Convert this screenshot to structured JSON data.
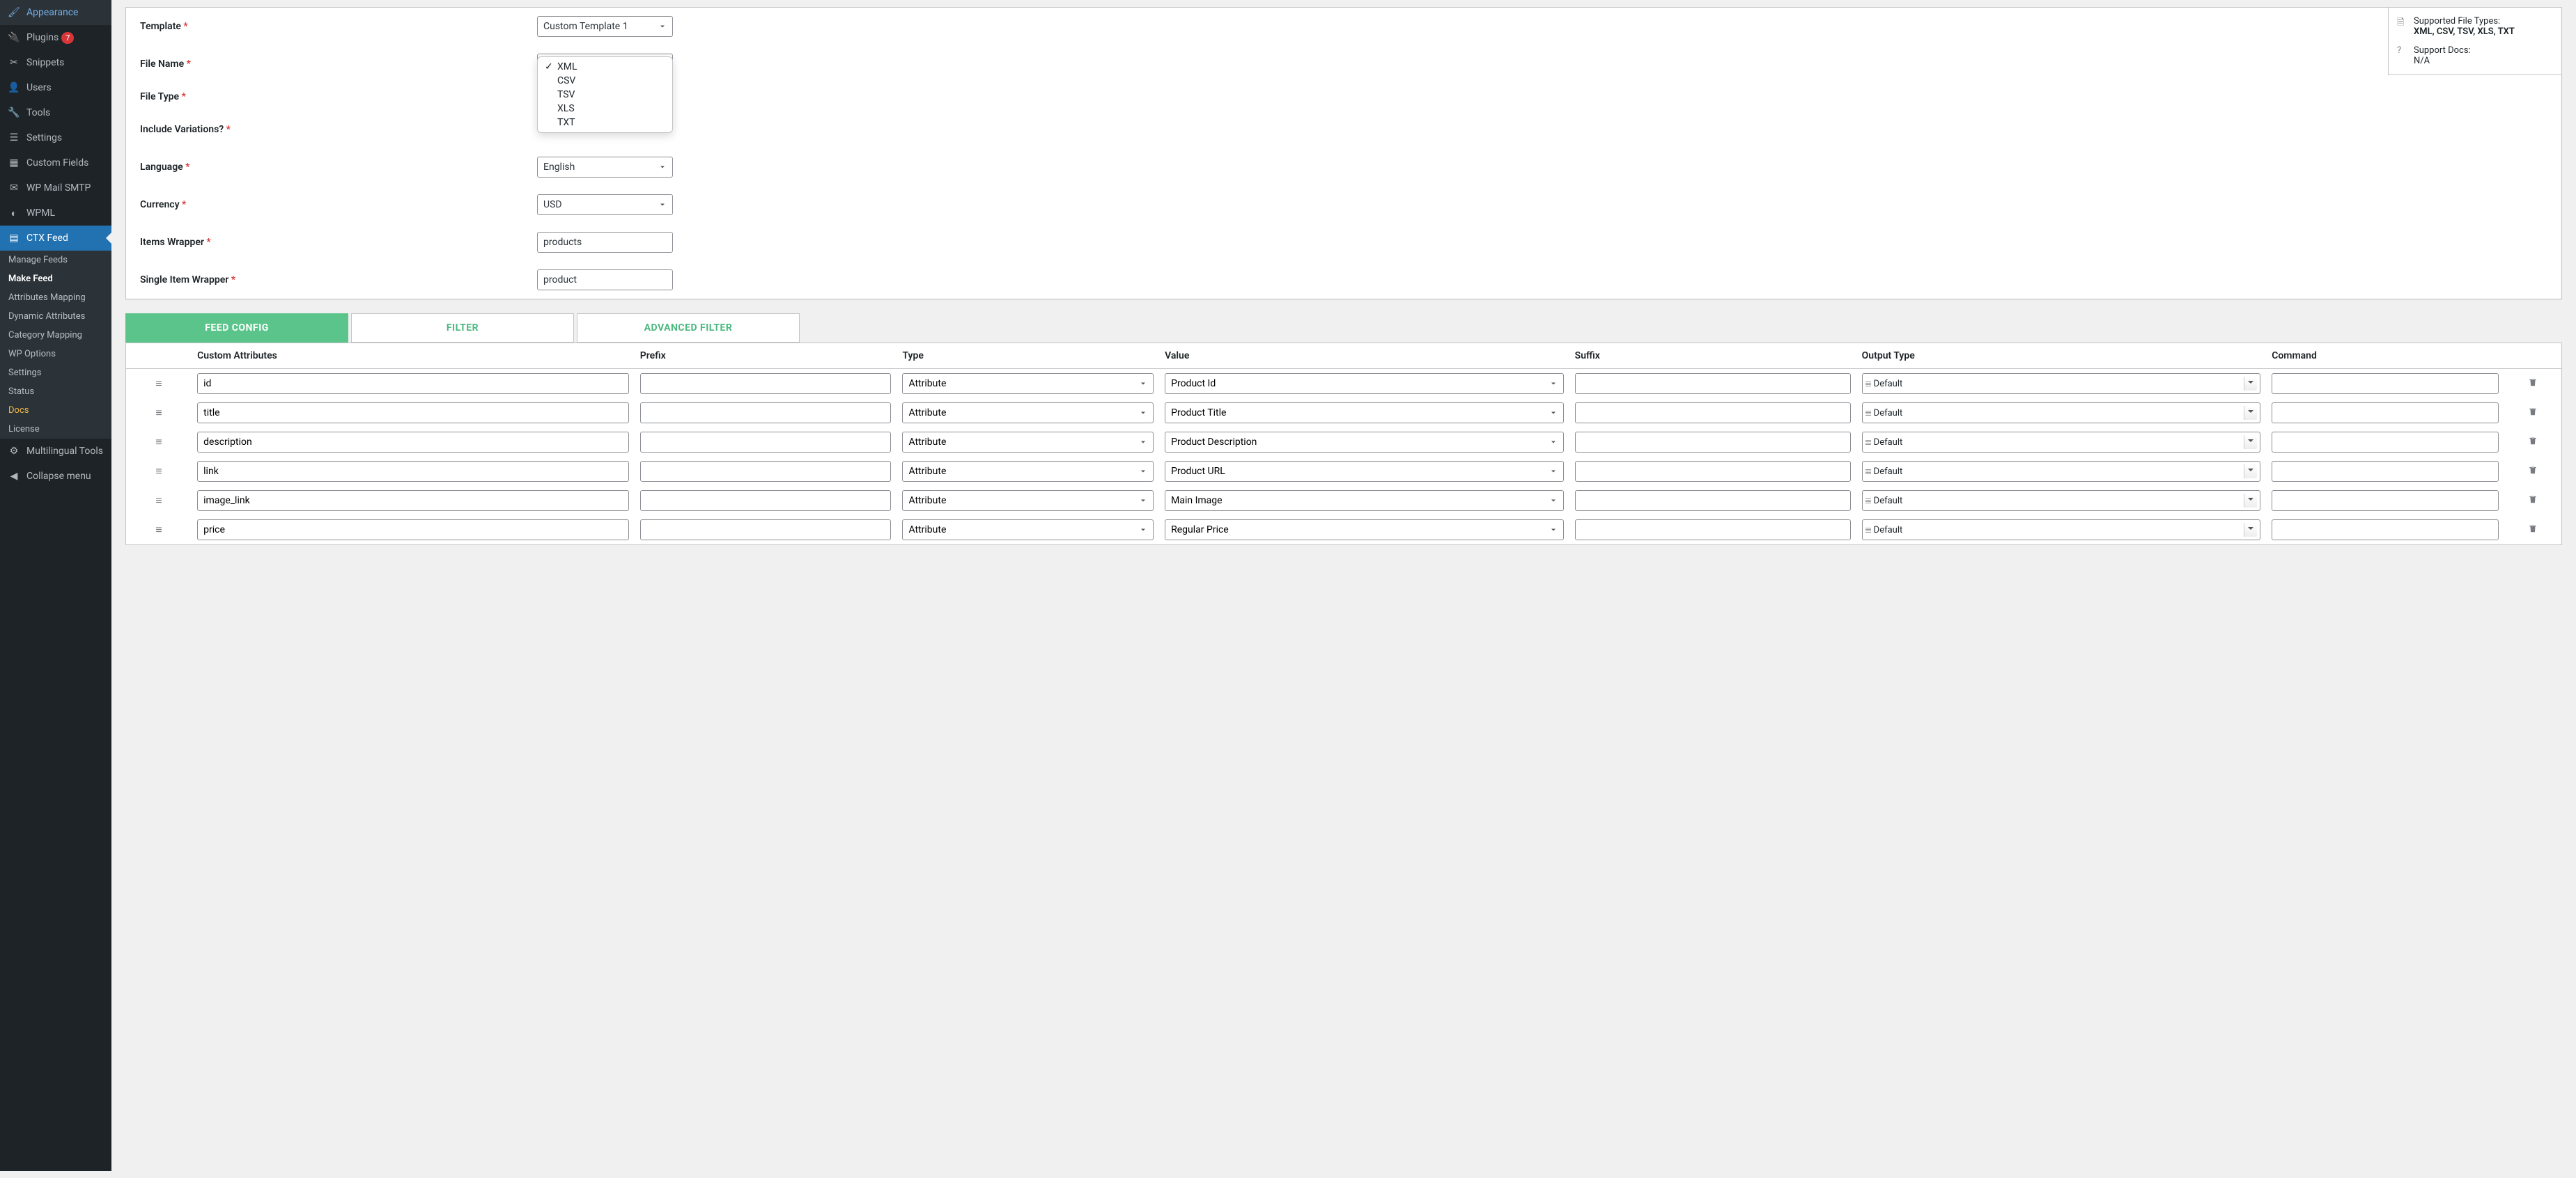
{
  "sidebar": {
    "items": [
      {
        "label": "Appearance",
        "icon": "brush"
      },
      {
        "label": "Plugins",
        "icon": "plug",
        "badge": "7"
      },
      {
        "label": "Snippets",
        "icon": "scissors"
      },
      {
        "label": "Users",
        "icon": "user"
      },
      {
        "label": "Tools",
        "icon": "wrench"
      },
      {
        "label": "Settings",
        "icon": "sliders"
      },
      {
        "label": "Custom Fields",
        "icon": "grid"
      },
      {
        "label": "WP Mail SMTP",
        "icon": "mail"
      },
      {
        "label": "WPML",
        "icon": "globe"
      },
      {
        "label": "CTX Feed",
        "icon": "feed",
        "active": true
      },
      {
        "label": "Multilingual Tools",
        "icon": "lang"
      },
      {
        "label": "Collapse menu",
        "icon": "collapse"
      }
    ],
    "submenu": [
      {
        "label": "Manage Feeds"
      },
      {
        "label": "Make Feed",
        "current": true
      },
      {
        "label": "Attributes Mapping"
      },
      {
        "label": "Dynamic Attributes"
      },
      {
        "label": "Category Mapping"
      },
      {
        "label": "WP Options"
      },
      {
        "label": "Settings"
      },
      {
        "label": "Status"
      },
      {
        "label": "Docs",
        "highlight": true
      },
      {
        "label": "License"
      }
    ]
  },
  "form": {
    "template": {
      "label": "Template",
      "value": "Custom Template 1"
    },
    "file_name": {
      "label": "File Name",
      "value": ""
    },
    "file_type": {
      "label": "File Type",
      "options": [
        "XML",
        "CSV",
        "TSV",
        "XLS",
        "TXT"
      ],
      "selected": "XML"
    },
    "include_variations": {
      "label": "Include Variations?"
    },
    "language": {
      "label": "Language",
      "value": "English"
    },
    "currency": {
      "label": "Currency",
      "value": "USD"
    },
    "items_wrapper": {
      "label": "Items Wrapper",
      "value": "products"
    },
    "single_item_wrapper": {
      "label": "Single Item Wrapper",
      "value": "product"
    }
  },
  "info": {
    "file_types_label": "Supported File Types:",
    "file_types_value": "XML, CSV, TSV, XLS, TXT",
    "docs_label": "Support Docs:",
    "docs_value": "N/A"
  },
  "tabs": [
    "FEED CONFIG",
    "FILTER",
    "ADVANCED FILTER"
  ],
  "table": {
    "headers": [
      "",
      "Custom Attributes",
      "Prefix",
      "Type",
      "Value",
      "Suffix",
      "Output Type",
      "Command",
      ""
    ],
    "attr_type": "Attribute",
    "output_type": "Default",
    "rows": [
      {
        "attr": "id",
        "value": "Product Id"
      },
      {
        "attr": "title",
        "value": "Product Title"
      },
      {
        "attr": "description",
        "value": "Product Description"
      },
      {
        "attr": "link",
        "value": "Product URL"
      },
      {
        "attr": "image_link",
        "value": "Main Image"
      },
      {
        "attr": "price",
        "value": "Regular Price"
      }
    ]
  }
}
